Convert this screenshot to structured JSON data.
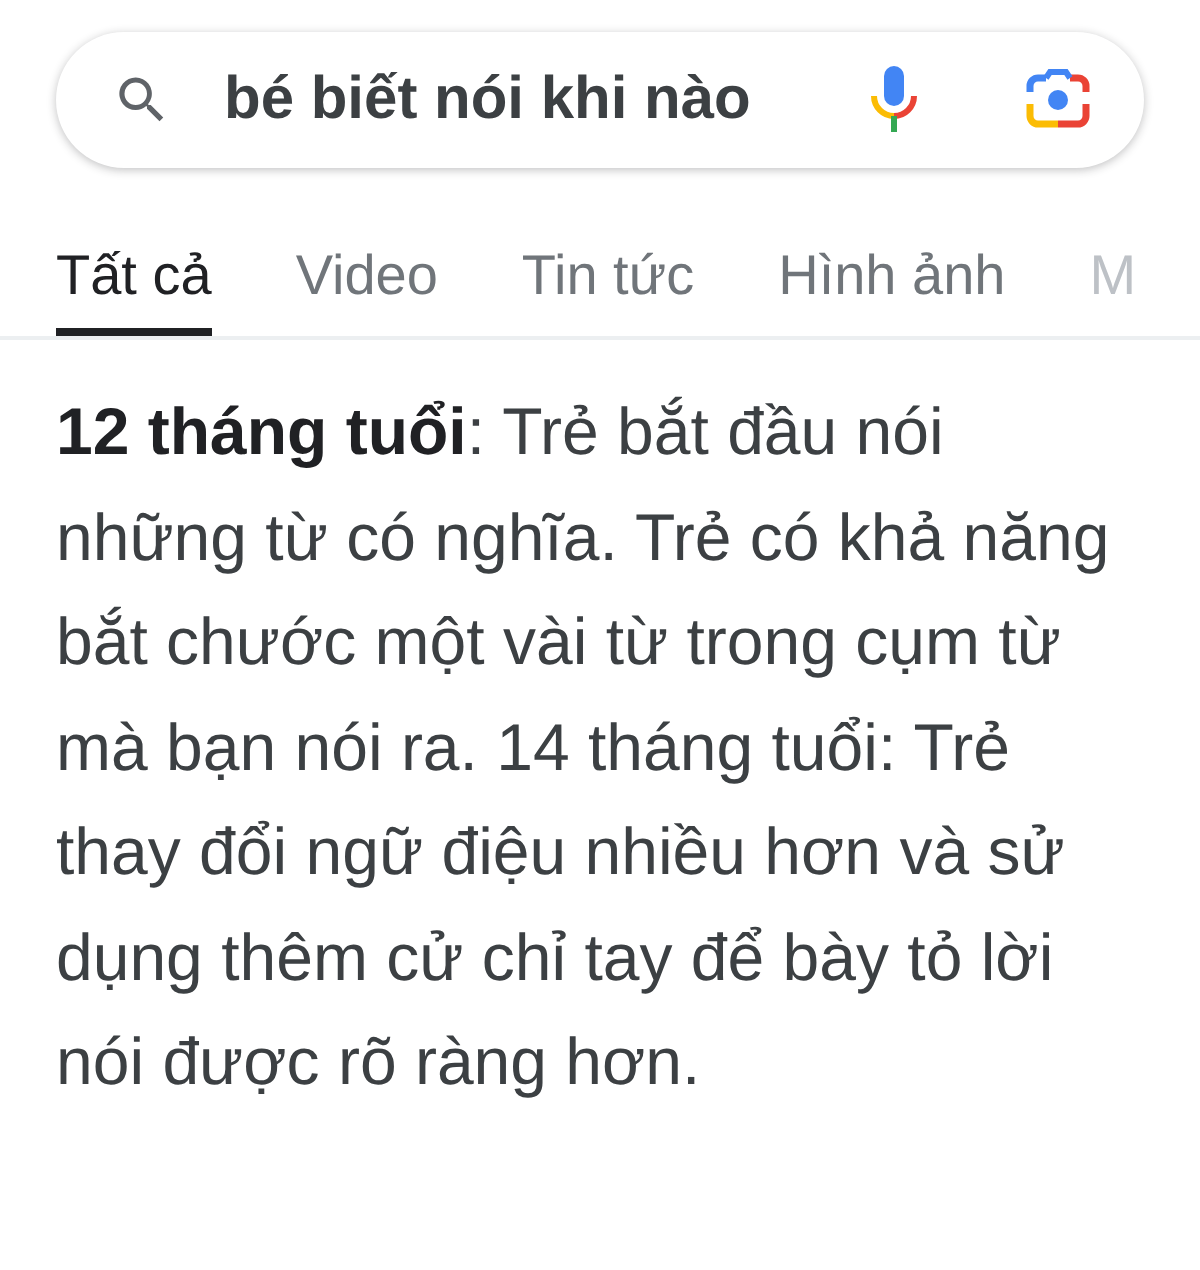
{
  "search": {
    "query": "bé biết nói khi nào"
  },
  "tabs": [
    {
      "label": "Tất cả",
      "selected": true
    },
    {
      "label": "Video",
      "selected": false
    },
    {
      "label": "Tin tức",
      "selected": false
    },
    {
      "label": "Hình ảnh",
      "selected": false
    },
    {
      "label": "M",
      "selected": false
    }
  ],
  "snippet": {
    "text": "**12 tháng tuổi**: Trẻ bắt đầu nói những từ có nghĩa. Trẻ có khả năng bắt chước một vài từ trong cụm từ mà bạn nói ra. 14 tháng tuổi: Trẻ thay đổi ngữ điệu nhiều hơn và sử dụng thêm cử chỉ tay để bày tỏ lời nói được rõ ràng hơn."
  }
}
